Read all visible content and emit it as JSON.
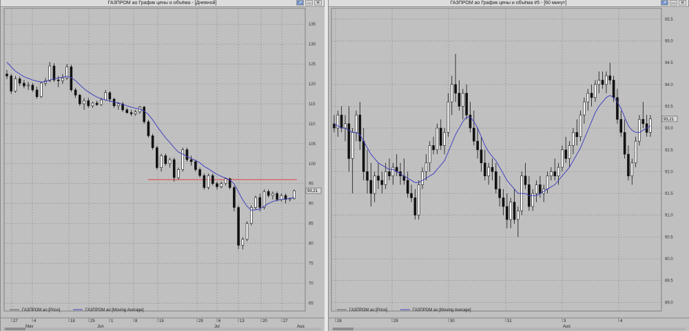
{
  "windows": {
    "left": {
      "title": "ГАЗПРОМ ао График цены и объёма - [Дневной]",
      "buttons": [
        "↗",
        "—",
        "✕"
      ]
    },
    "right": {
      "title": "ГАЗПРОМ ао График цены и объёма #5 - [60 минут]",
      "buttons": [
        "↗",
        "—",
        "✕"
      ]
    }
  },
  "chart_data": [
    {
      "type": "candlestick",
      "timeframe": "Дневной",
      "y_ticks": [
        135,
        130,
        125,
        120,
        115,
        110,
        105,
        100,
        95,
        90,
        85,
        80,
        75,
        70,
        65
      ],
      "ylim": [
        63,
        139
      ],
      "price_label": "93,21",
      "x_ticks_top": [
        "27",
        "4",
        "18",
        "25",
        "1",
        "8",
        "15",
        "29",
        "6",
        "13",
        "20",
        "27"
      ],
      "x_ticks_bottom": [
        "May",
        "Jun",
        "Jul",
        "Aug"
      ],
      "horizontal_line": {
        "value": 96,
        "color": "#e04040"
      },
      "legend": [
        {
          "name": "ГАЗПРОМ ао [Price]",
          "color": "#606060"
        },
        {
          "name": "ГАЗПРОМ ао [Moving Average]",
          "color": "#4040c0"
        }
      ],
      "candles": [
        [
          122.5,
          123.5,
          121.2,
          122.0
        ],
        [
          122.0,
          122.5,
          117.5,
          118.2
        ],
        [
          118.2,
          122.0,
          117.8,
          121.3
        ],
        [
          121.3,
          121.8,
          119.5,
          120.2
        ],
        [
          120.2,
          121.0,
          118.9,
          119.5
        ],
        [
          119.5,
          120.5,
          118.5,
          119.7
        ],
        [
          119.7,
          120.2,
          118.0,
          118.5
        ],
        [
          118.5,
          119.3,
          116.3,
          116.8
        ],
        [
          116.8,
          120.5,
          116.5,
          120.2
        ],
        [
          120.2,
          121.5,
          119.5,
          120.8
        ],
        [
          120.8,
          125.5,
          120.5,
          124.5
        ],
        [
          124.5,
          125.2,
          120.5,
          121.0
        ],
        [
          121.0,
          122.0,
          119.2,
          120.8
        ],
        [
          120.8,
          122.5,
          120.0,
          121.5
        ],
        [
          121.5,
          125.0,
          121.0,
          124.3
        ],
        [
          124.3,
          124.8,
          118.0,
          118.5
        ],
        [
          118.5,
          119.0,
          116.5,
          117.2
        ],
        [
          117.2,
          117.5,
          114.5,
          115.0
        ],
        [
          115.0,
          116.5,
          113.5,
          115.8
        ],
        [
          115.8,
          116.5,
          114.0,
          114.5
        ],
        [
          114.5,
          115.5,
          114.0,
          115.2
        ],
        [
          115.2,
          115.8,
          114.5,
          114.8
        ],
        [
          114.8,
          116.5,
          114.5,
          116.0
        ],
        [
          116.0,
          118.5,
          115.8,
          117.8
        ],
        [
          117.8,
          118.2,
          115.5,
          116.2
        ],
        [
          116.2,
          116.5,
          114.0,
          114.5
        ],
        [
          114.5,
          115.5,
          113.5,
          115.0
        ],
        [
          115.0,
          115.5,
          113.0,
          113.5
        ],
        [
          113.5,
          114.0,
          112.5,
          112.8
        ],
        [
          112.8,
          113.5,
          112.0,
          112.5
        ],
        [
          112.5,
          113.5,
          112.0,
          113.0
        ],
        [
          113.0,
          114.5,
          112.5,
          114.2
        ],
        [
          114.2,
          114.5,
          110.0,
          110.5
        ],
        [
          110.5,
          111.0,
          106.5,
          107.0
        ],
        [
          107.0,
          107.5,
          103.5,
          104.0
        ],
        [
          104.0,
          104.5,
          98.5,
          99.0
        ],
        [
          99.0,
          102.5,
          98.0,
          102.0
        ],
        [
          102.0,
          102.5,
          99.5,
          100.0
        ],
        [
          100.0,
          101.5,
          99.0,
          101.0
        ],
        [
          101.0,
          101.5,
          95.5,
          96.5
        ],
        [
          96.5,
          99.0,
          96.0,
          98.5
        ],
        [
          98.5,
          104.0,
          98.0,
          103.5
        ],
        [
          103.5,
          104.0,
          100.5,
          101.0
        ],
        [
          101.0,
          102.0,
          99.5,
          100.5
        ],
        [
          100.5,
          101.0,
          98.0,
          98.5
        ],
        [
          98.5,
          99.0,
          96.5,
          97.0
        ],
        [
          97.0,
          97.5,
          93.5,
          94.0
        ],
        [
          94.0,
          97.5,
          93.5,
          97.0
        ],
        [
          97.0,
          97.5,
          94.5,
          95.0
        ],
        [
          95.0,
          95.5,
          93.5,
          94.2
        ],
        [
          94.2,
          95.5,
          93.8,
          95.0
        ],
        [
          95.0,
          96.5,
          94.5,
          96.2
        ],
        [
          96.2,
          96.5,
          93.5,
          94.0
        ],
        [
          94.0,
          94.5,
          88.0,
          89.0
        ],
        [
          89.0,
          89.5,
          78.5,
          79.5
        ],
        [
          79.5,
          81.5,
          78.5,
          81.0
        ],
        [
          81.0,
          85.5,
          80.5,
          85.0
        ],
        [
          85.0,
          89.5,
          84.5,
          89.0
        ],
        [
          89.0,
          92.0,
          88.5,
          91.5
        ],
        [
          91.5,
          92.5,
          88.0,
          89.0
        ],
        [
          89.0,
          93.5,
          88.5,
          93.0
        ],
        [
          93.0,
          93.5,
          91.5,
          92.0
        ],
        [
          92.0,
          93.0,
          91.0,
          92.5
        ],
        [
          92.5,
          93.0,
          90.5,
          91.0
        ],
        [
          91.0,
          92.5,
          90.5,
          92.0
        ],
        [
          92.0,
          92.5,
          90.0,
          91.0
        ],
        [
          91.0,
          91.5,
          90.5,
          91.2
        ],
        [
          91.2,
          93.5,
          91.0,
          93.21
        ]
      ],
      "moving_average": [
        125.5,
        124.3,
        123.2,
        122.5,
        121.8,
        121.4,
        121.0,
        120.7,
        120.5,
        120.6,
        121.0,
        121.3,
        121.5,
        121.7,
        121.9,
        121.6,
        120.8,
        119.8,
        118.8,
        118.0,
        117.3,
        116.7,
        116.3,
        116.0,
        115.7,
        115.5,
        115.2,
        114.9,
        114.5,
        114.2,
        113.9,
        113.7,
        113.2,
        112.3,
        111.0,
        109.4,
        107.9,
        106.5,
        105.3,
        104.0,
        102.9,
        102.4,
        101.8,
        101.3,
        100.8,
        100.2,
        99.3,
        98.7,
        98.0,
        97.3,
        96.8,
        96.4,
        95.9,
        94.9,
        92.9,
        90.9,
        89.3,
        88.3,
        88.4,
        88.6,
        89.3,
        90.0,
        90.5,
        90.8,
        91.0,
        91.1,
        91.3,
        91.5
      ]
    },
    {
      "type": "candlestick",
      "timeframe": "60 минут",
      "y_ticks": [
        95.5,
        95.0,
        94.5,
        94.0,
        93.5,
        93.0,
        92.5,
        92.0,
        91.5,
        91.0,
        90.5,
        90.0,
        89.5,
        89.0
      ],
      "ylim": [
        88.8,
        95.75
      ],
      "price_label": "93,21",
      "x_ticks_top": [
        "28",
        "29",
        "30",
        "31",
        "3",
        "4"
      ],
      "x_ticks_bottom": [
        "Aug"
      ],
      "legend": [
        {
          "name": "ГАЗПРОМ ао [Price]",
          "color": "#606060"
        },
        {
          "name": "ГАЗПРОМ ао [Moving Average]",
          "color": "#4040c0"
        }
      ],
      "candles": [
        [
          93.1,
          93.3,
          92.9,
          93.0
        ],
        [
          93.0,
          93.4,
          92.8,
          93.3
        ],
        [
          93.3,
          93.5,
          92.9,
          93.0
        ],
        [
          93.0,
          93.3,
          92.7,
          93.1
        ],
        [
          93.1,
          93.5,
          92.0,
          92.3
        ],
        [
          92.3,
          93.0,
          91.5,
          92.9
        ],
        [
          92.9,
          93.4,
          92.7,
          93.3
        ],
        [
          93.3,
          93.6,
          92.5,
          92.7
        ],
        [
          92.7,
          93.0,
          91.8,
          92.0
        ],
        [
          92.0,
          92.5,
          91.5,
          91.8
        ],
        [
          91.8,
          92.2,
          91.2,
          91.5
        ],
        [
          91.5,
          92.0,
          91.3,
          91.9
        ],
        [
          91.9,
          92.2,
          91.6,
          91.8
        ],
        [
          91.8,
          92.0,
          91.5,
          91.7
        ],
        [
          91.7,
          92.2,
          91.6,
          92.0
        ],
        [
          92.0,
          92.3,
          91.8,
          91.9
        ],
        [
          91.9,
          92.2,
          91.7,
          92.1
        ],
        [
          92.1,
          92.4,
          91.9,
          92.0
        ],
        [
          92.0,
          92.2,
          91.7,
          91.9
        ],
        [
          91.9,
          92.3,
          91.7,
          91.8
        ],
        [
          91.8,
          92.0,
          91.4,
          91.5
        ],
        [
          91.5,
          91.7,
          91.3,
          91.4
        ],
        [
          91.4,
          91.6,
          90.9,
          91.0
        ],
        [
          91.0,
          91.8,
          90.9,
          91.7
        ],
        [
          91.7,
          92.1,
          91.6,
          92.0
        ],
        [
          92.0,
          92.4,
          91.8,
          92.2
        ],
        [
          92.2,
          92.7,
          92.0,
          92.6
        ],
        [
          92.6,
          92.8,
          92.4,
          92.5
        ],
        [
          92.5,
          93.1,
          92.4,
          93.0
        ],
        [
          93.0,
          93.2,
          92.5,
          92.6
        ],
        [
          92.6,
          93.0,
          92.4,
          92.9
        ],
        [
          92.9,
          93.8,
          92.8,
          93.6
        ],
        [
          93.6,
          94.2,
          93.3,
          94.0
        ],
        [
          94.0,
          94.7,
          93.6,
          93.8
        ],
        [
          93.8,
          94.1,
          93.4,
          93.5
        ],
        [
          93.5,
          93.9,
          93.2,
          93.8
        ],
        [
          93.8,
          94.0,
          93.2,
          93.3
        ],
        [
          93.3,
          93.6,
          92.9,
          93.0
        ],
        [
          93.0,
          93.4,
          92.6,
          92.7
        ],
        [
          92.7,
          93.0,
          92.3,
          92.5
        ],
        [
          92.5,
          92.8,
          92.0,
          92.2
        ],
        [
          92.2,
          92.5,
          91.8,
          91.9
        ],
        [
          91.9,
          92.2,
          91.7,
          92.1
        ],
        [
          92.1,
          92.3,
          91.8,
          92.0
        ],
        [
          92.0,
          92.2,
          91.5,
          91.6
        ],
        [
          91.6,
          91.9,
          91.2,
          91.4
        ],
        [
          91.4,
          91.6,
          91.0,
          91.2
        ],
        [
          91.2,
          91.5,
          90.7,
          90.9
        ],
        [
          90.9,
          91.4,
          90.7,
          91.3
        ],
        [
          91.3,
          91.6,
          90.8,
          90.9
        ],
        [
          90.9,
          91.2,
          90.5,
          91.1
        ],
        [
          91.1,
          92.0,
          91.0,
          91.9
        ],
        [
          91.9,
          92.2,
          91.6,
          91.7
        ],
        [
          91.7,
          91.9,
          91.1,
          91.2
        ],
        [
          91.2,
          91.6,
          91.1,
          91.5
        ],
        [
          91.5,
          91.8,
          91.3,
          91.7
        ],
        [
          91.7,
          91.9,
          91.4,
          91.5
        ],
        [
          91.5,
          91.7,
          91.3,
          91.6
        ],
        [
          91.6,
          92.0,
          91.5,
          91.9
        ],
        [
          91.9,
          92.1,
          91.8,
          92.0
        ],
        [
          92.0,
          92.3,
          91.8,
          91.9
        ],
        [
          91.9,
          92.2,
          91.7,
          92.1
        ],
        [
          92.1,
          92.6,
          92.0,
          92.5
        ],
        [
          92.5,
          92.8,
          92.2,
          92.3
        ],
        [
          92.3,
          92.7,
          92.1,
          92.6
        ],
        [
          92.6,
          93.0,
          92.4,
          92.9
        ],
        [
          92.9,
          93.2,
          92.6,
          92.8
        ],
        [
          92.8,
          93.4,
          92.7,
          93.3
        ],
        [
          93.3,
          93.7,
          93.1,
          93.6
        ],
        [
          93.6,
          93.9,
          93.4,
          93.8
        ],
        [
          93.8,
          94.0,
          93.5,
          93.7
        ],
        [
          93.7,
          94.1,
          93.6,
          94.0
        ],
        [
          94.0,
          94.3,
          93.8,
          94.1
        ],
        [
          94.1,
          94.3,
          93.9,
          94.0
        ],
        [
          94.0,
          94.3,
          93.8,
          94.2
        ],
        [
          94.2,
          94.5,
          94.0,
          94.1
        ],
        [
          94.1,
          94.2,
          93.6,
          93.7
        ],
        [
          93.7,
          93.9,
          93.1,
          93.2
        ],
        [
          93.2,
          93.4,
          92.8,
          92.9
        ],
        [
          92.9,
          93.2,
          92.3,
          92.4
        ],
        [
          92.4,
          92.6,
          91.8,
          91.9
        ],
        [
          91.9,
          92.3,
          91.7,
          92.2
        ],
        [
          92.2,
          92.8,
          92.1,
          92.7
        ],
        [
          92.7,
          93.3,
          92.6,
          93.2
        ],
        [
          93.2,
          93.6,
          93.0,
          93.1
        ],
        [
          93.1,
          93.3,
          92.8,
          92.9
        ],
        [
          92.9,
          93.3,
          92.8,
          93.21
        ]
      ],
      "moving_average": [
        93.1,
        93.05,
        93.0,
        93.0,
        92.95,
        92.9,
        92.9,
        92.85,
        92.7,
        92.55,
        92.4,
        92.3,
        92.2,
        92.15,
        92.1,
        92.05,
        92.05,
        92.0,
        91.95,
        91.9,
        91.85,
        91.8,
        91.75,
        91.75,
        91.8,
        91.85,
        91.9,
        91.95,
        92.05,
        92.15,
        92.25,
        92.45,
        92.65,
        92.85,
        93.0,
        93.15,
        93.25,
        93.25,
        93.15,
        93.0,
        92.8,
        92.6,
        92.45,
        92.35,
        92.25,
        92.1,
        91.95,
        91.8,
        91.7,
        91.6,
        91.5,
        91.5,
        91.5,
        91.45,
        91.45,
        91.45,
        91.5,
        91.55,
        91.6,
        91.65,
        91.7,
        91.8,
        91.9,
        92.0,
        92.1,
        92.25,
        92.4,
        92.55,
        92.75,
        92.95,
        93.15,
        93.35,
        93.5,
        93.6,
        93.7,
        93.75,
        93.7,
        93.6,
        93.45,
        93.25,
        93.05,
        92.95,
        92.9,
        92.9,
        92.95,
        93.0,
        93.05
      ]
    }
  ]
}
